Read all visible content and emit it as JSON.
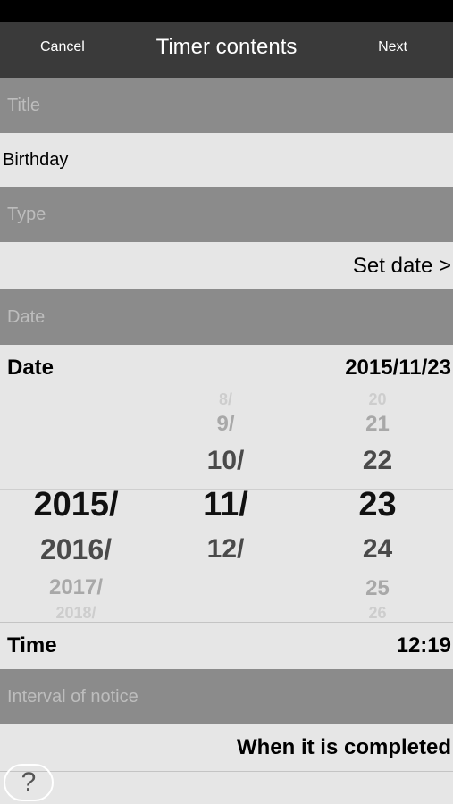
{
  "nav": {
    "cancel_label": "Cancel",
    "title": "Timer contents",
    "next_label": "Next"
  },
  "sections": {
    "title_header": "Title",
    "type_header": "Type",
    "date_header": "Date",
    "interval_header": "Interval of notice"
  },
  "title_value": "Birthday",
  "type_value": "Set date >",
  "date_row": {
    "label": "Date",
    "value": "2015/11/23"
  },
  "picker": {
    "years": [
      "2015/",
      "2016/",
      "2017/",
      "2018/"
    ],
    "months": [
      "8/",
      "9/",
      "10/",
      "11/",
      "12/"
    ],
    "days": [
      "20",
      "21",
      "22",
      "23",
      "24",
      "25",
      "26"
    ],
    "selected": {
      "year": "2015/",
      "month": "11/",
      "day": "23"
    }
  },
  "time_row": {
    "label": "Time",
    "value": "12:19"
  },
  "interval_value": "When it is completed",
  "help_icon_glyph": "?"
}
